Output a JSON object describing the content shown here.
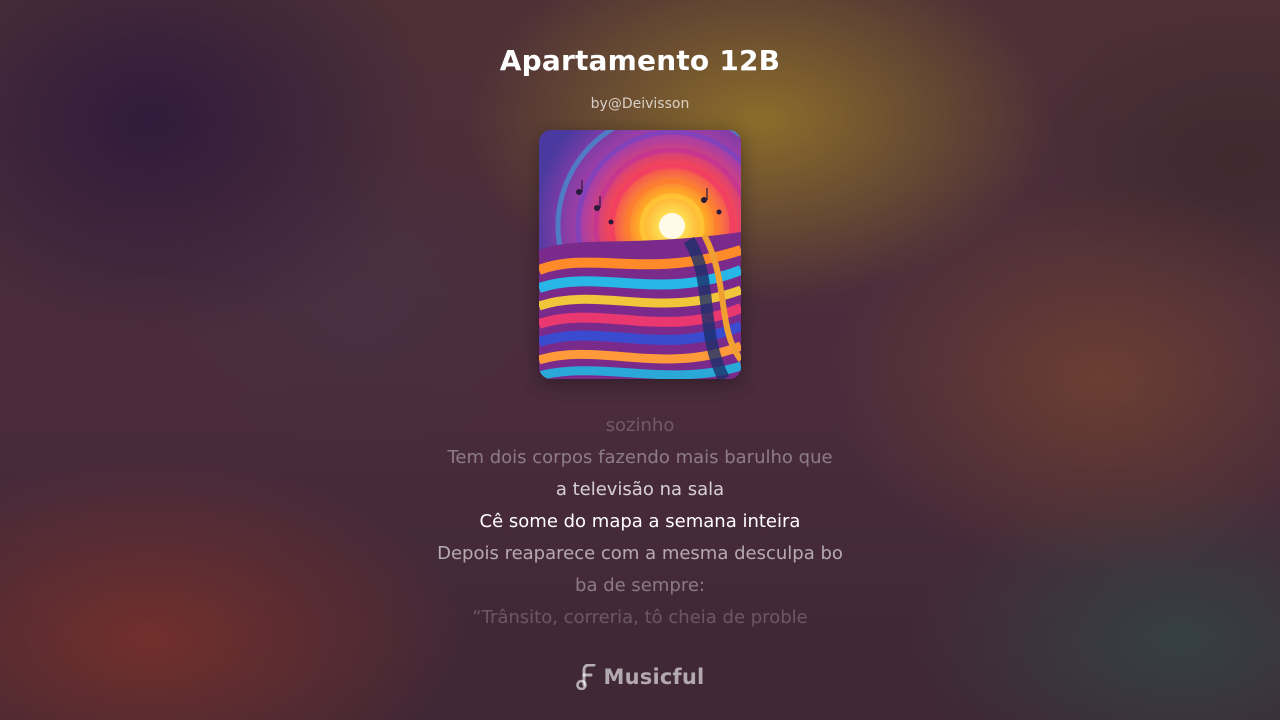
{
  "song": {
    "title": "Apartamento 12B",
    "author": "by@Deivisson"
  },
  "cover": {
    "icon": "abstract-sunset-music-artwork"
  },
  "lyrics": {
    "lines": [
      {
        "text": "sozinho",
        "state": "past"
      },
      {
        "text": "Tem dois corpos fazendo mais barulho que",
        "state": "past"
      },
      {
        "text": "a televisão na sala",
        "state": "previous"
      },
      {
        "text": "Cê some do mapa a semana inteira",
        "state": "current"
      },
      {
        "text": "Depois reaparece com a mesma desculpa bo",
        "state": "next"
      },
      {
        "text": "ba de sempre:",
        "state": "upcoming"
      },
      {
        "text": "“Trânsito, correria, tô cheia de proble",
        "state": "upcoming"
      }
    ]
  },
  "brand": {
    "name": "Musicful",
    "icon": "music-note-logo-icon"
  },
  "colors": {
    "text": "#ffffff",
    "background": "#4a2d3a"
  }
}
